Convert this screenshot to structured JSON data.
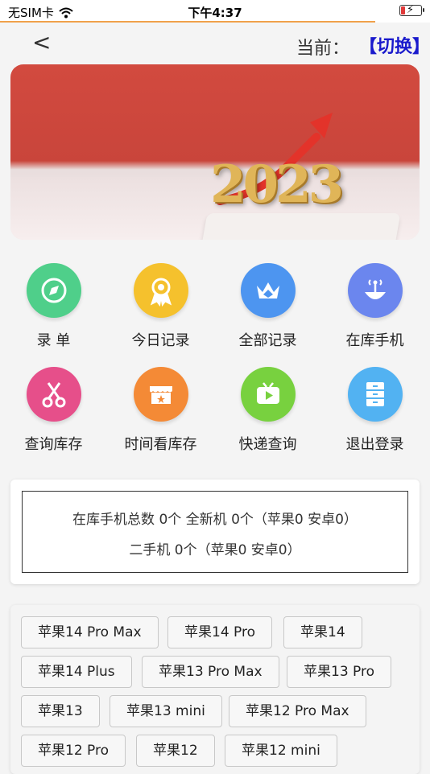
{
  "status_bar": {
    "carrier": "无SIM卡",
    "time": "下午4:37"
  },
  "nav": {
    "back": "<",
    "current_label": "当前：",
    "switch_label": "【切换】"
  },
  "banner": {
    "year_text": "2023"
  },
  "menu": [
    {
      "label": "录 单",
      "icon": "compass-icon",
      "color": "#4fcf8a"
    },
    {
      "label": "今日记录",
      "icon": "award-icon",
      "color": "#f5c12d"
    },
    {
      "label": "全部记录",
      "icon": "crown-icon",
      "color": "#4d95f0"
    },
    {
      "label": "在库手机",
      "icon": "antenna-icon",
      "color": "#6b86ee"
    },
    {
      "label": "查询库存",
      "icon": "scissors-icon",
      "color": "#e64f8a"
    },
    {
      "label": "时间看库存",
      "icon": "store-icon",
      "color": "#f48a36"
    },
    {
      "label": "快递查询",
      "icon": "tv-icon",
      "color": "#78d13f"
    },
    {
      "label": "退出登录",
      "icon": "cabinet-icon",
      "color": "#52b2f2"
    }
  ],
  "stats": {
    "line1": "在库手机总数 0个    全新机 0个（苹果0 安卓0）",
    "line2": "二手机 0个（苹果0 安卓0）"
  },
  "models": [
    "苹果14 Pro Max",
    "苹果14 Pro",
    "苹果14",
    "苹果14 Plus",
    "苹果13 Pro Max",
    "苹果13 Pro",
    "苹果13",
    "苹果13 mini",
    "苹果12 Pro Max",
    "苹果12 Pro",
    "苹果12",
    "苹果12 mini"
  ]
}
